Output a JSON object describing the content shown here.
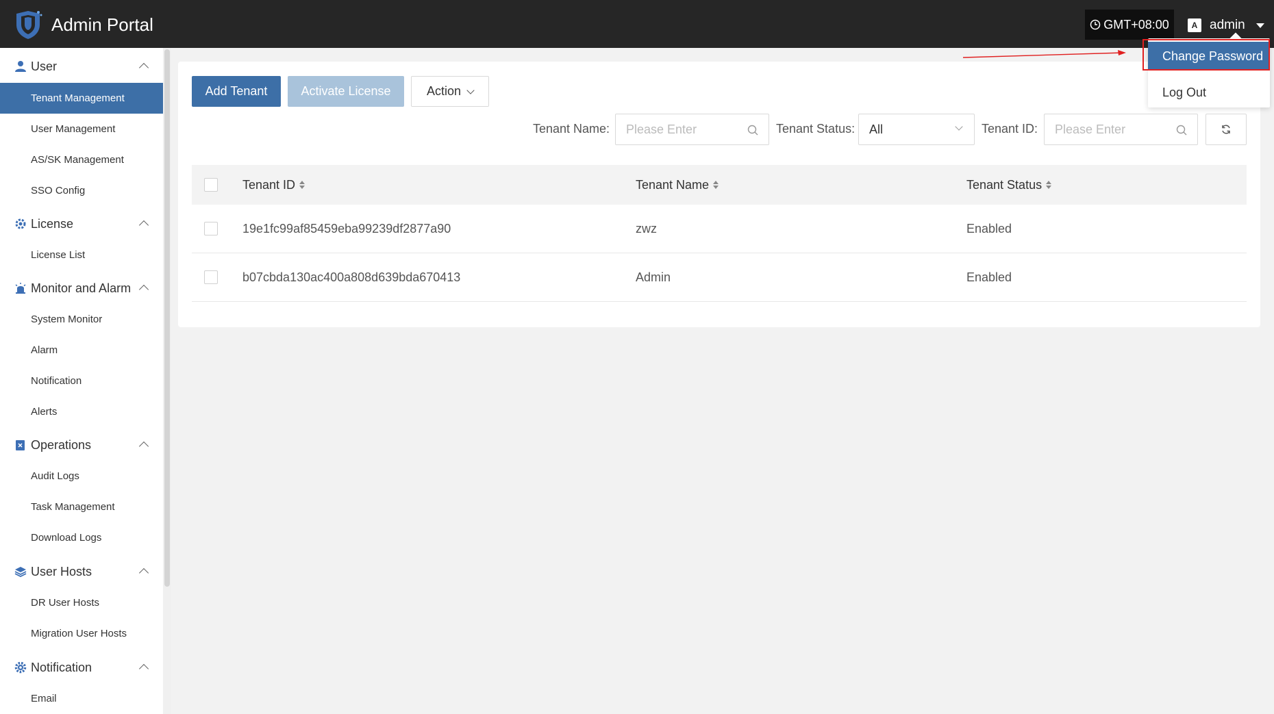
{
  "header": {
    "title": "Admin Portal",
    "timezone": "GMT+08:00",
    "lang_icon_text": "A",
    "username": "admin"
  },
  "sidebar": {
    "groups": [
      {
        "label": "User",
        "icon": "user-icon",
        "items": [
          "Tenant Management",
          "User Management",
          "AS/SK Management",
          "SSO Config"
        ]
      },
      {
        "label": "License",
        "icon": "license-gear-icon",
        "items": [
          "License List"
        ]
      },
      {
        "label": "Monitor and Alarm",
        "icon": "alarm-icon",
        "items": [
          "System Monitor",
          "Alarm",
          "Notification",
          "Alerts"
        ]
      },
      {
        "label": "Operations",
        "icon": "operations-icon",
        "items": [
          "Audit Logs",
          "Task Management",
          "Download Logs"
        ]
      },
      {
        "label": "User Hosts",
        "icon": "layers-icon",
        "items": [
          "DR User Hosts",
          "Migration User Hosts"
        ]
      },
      {
        "label": "Notification",
        "icon": "gear-icon",
        "items": [
          "Email"
        ]
      }
    ],
    "active_item": "Tenant Management"
  },
  "toolbar": {
    "add_tenant": "Add Tenant",
    "activate_license": "Activate License",
    "action": "Action"
  },
  "filters": {
    "tenant_name_label": "Tenant Name:",
    "tenant_name_placeholder": "Please Enter",
    "tenant_status_label": "Tenant Status:",
    "tenant_status_value": "All",
    "tenant_id_label": "Tenant ID:",
    "tenant_id_placeholder": "Please Enter"
  },
  "table": {
    "columns": [
      "Tenant ID",
      "Tenant Name",
      "Tenant Status"
    ],
    "rows": [
      {
        "id": "19e1fc99af85459eba99239df2877a90",
        "name": "zwz",
        "status": "Enabled"
      },
      {
        "id": "b07cbda130ac400a808d639bda670413",
        "name": "Admin",
        "status": "Enabled"
      }
    ]
  },
  "user_dropdown": {
    "items": [
      "Change Password",
      "Log Out"
    ]
  },
  "colors": {
    "topbar": "#262626",
    "primary": "#3d6fa7",
    "primary_disabled": "#a9c3db",
    "annotation_red": "#e02020"
  }
}
